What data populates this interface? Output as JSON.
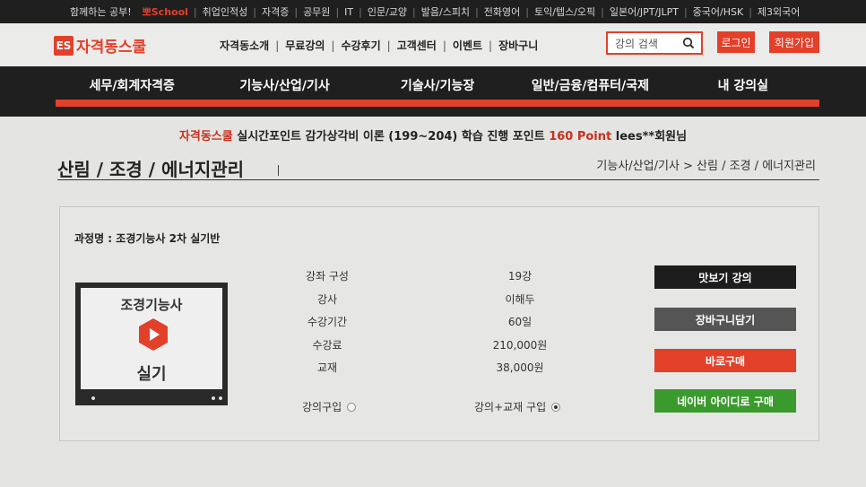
{
  "topbar": {
    "items": [
      {
        "label": "함께하는 공부!",
        "type": "text"
      },
      {
        "label": "뽀School",
        "type": "brand"
      },
      {
        "label": "취업인적성"
      },
      {
        "label": "자격증"
      },
      {
        "label": "공무원"
      },
      {
        "label": "IT"
      },
      {
        "label": "인문/교양"
      },
      {
        "label": "발음/스피치"
      },
      {
        "label": "전화영어"
      },
      {
        "label": "토익/텝스/오픽"
      },
      {
        "label": "일본어/JPT/JLPT"
      },
      {
        "label": "중국어/HSK"
      },
      {
        "label": "제3외국어"
      }
    ]
  },
  "header": {
    "logo_mark": "ES",
    "logo_text": "자격동스쿨",
    "nav": [
      "자격동소개",
      "무료강의",
      "수강후기",
      "고객센터",
      "이벤트",
      "장바구니"
    ],
    "search_placeholder": "강의 검색",
    "search_icon": "search-icon",
    "login_label": "로그인",
    "join_label": "회원가입"
  },
  "categories": [
    "세무/회계자격증",
    "기능사/산업/기사",
    "기술사/기능장",
    "일반/금융/컴퓨터/국제",
    "내 강의실"
  ],
  "points_banner": {
    "brand": "자격동스쿨",
    "text1": "실시간포인트 감가상각비 이론 (199~204) 학습 진행 포인트",
    "points": "160 Point",
    "text2": "lees**회원님"
  },
  "page": {
    "title": "산림 / 조경 / 에너지관리",
    "breadcrumb": "기능사/산업/기사 > 산림 / 조경 / 에너지관리"
  },
  "course": {
    "name_label": "과정명 : 조경기능사 2차 실기반",
    "thumb_top": "조경기능사",
    "thumb_bottom": "실기",
    "thumb_icon": "play-icon",
    "info": [
      {
        "key": "강좌 구성",
        "value": "19강"
      },
      {
        "key": "강사",
        "value": "이해두"
      },
      {
        "key": "수강기간",
        "value": "60일"
      },
      {
        "key": "수강료",
        "value": "210,000원"
      },
      {
        "key": "교재",
        "value": "38,000원"
      }
    ],
    "option_lecture": "강의구입",
    "option_lecture_book": "강의+교재 구입",
    "selected_option": "강의+교재 구입"
  },
  "actions": {
    "preview": "맛보기 강의",
    "cart": "장바구니담기",
    "buy": "바로구매",
    "naver": "네이버 아이디로 구매"
  },
  "colors": {
    "accent": "#e3402a",
    "dark": "#1f1f1f",
    "naver_green": "#3b9a2e"
  }
}
